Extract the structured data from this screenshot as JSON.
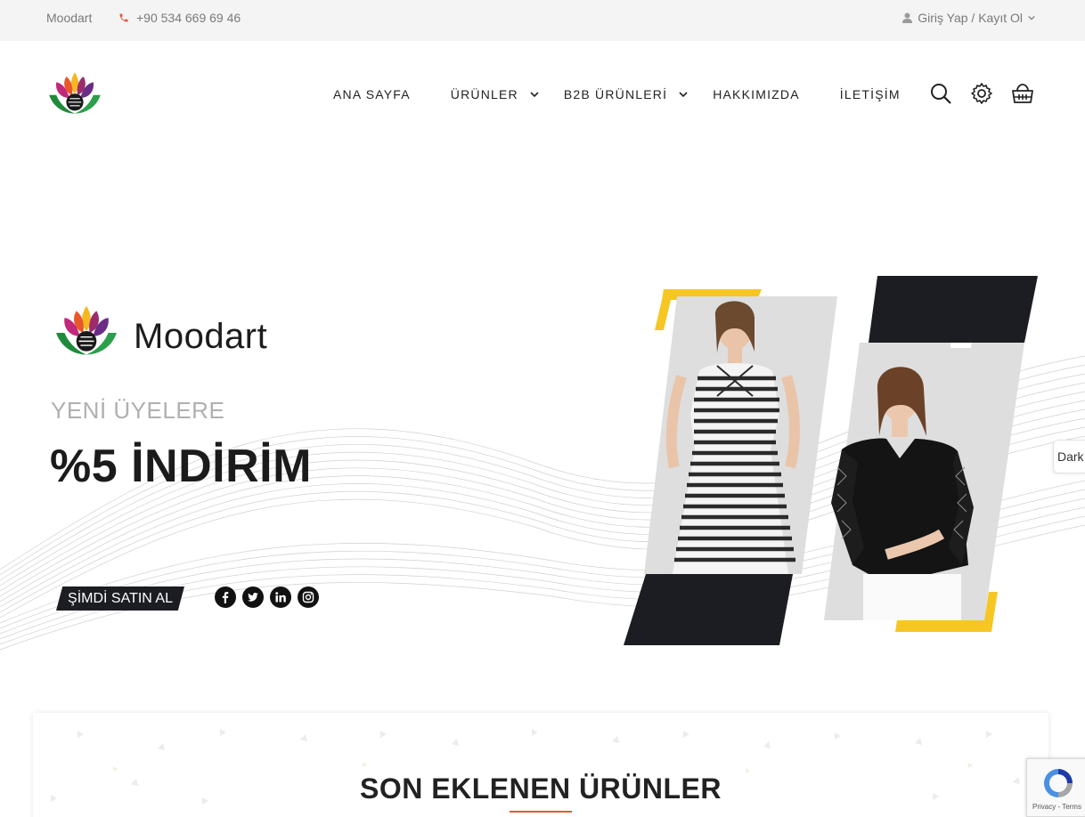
{
  "topbar": {
    "brand": "Moodart",
    "phone": "+90 534 669 69 46",
    "account": "Giriş Yap / Kayıt Ol"
  },
  "nav": {
    "items": [
      {
        "label": "ANA SAYFA",
        "has_dropdown": false
      },
      {
        "label": "ÜRÜNLER",
        "has_dropdown": true
      },
      {
        "label": "B2B ÜRÜNLERİ",
        "has_dropdown": true
      },
      {
        "label": "HAKKIMIZDA",
        "has_dropdown": false
      },
      {
        "label": "İLETİŞİM",
        "has_dropdown": false
      }
    ],
    "icons": [
      "search-icon",
      "settings-gear-icon",
      "shopping-basket-icon"
    ]
  },
  "hero": {
    "logo_text": "Moodart",
    "tagline": "YENİ ÜYELERE",
    "headline": "%5 İNDİRİM",
    "cta_label": "ŞİMDİ SATIN AL",
    "socials": [
      "facebook-icon",
      "twitter-icon",
      "linkedin-icon",
      "instagram-icon"
    ]
  },
  "dark_toggle": {
    "label": "Dark"
  },
  "latest": {
    "title": "SON EKLENEN ÜRÜNLER"
  },
  "recaptcha": {
    "links": "Privacy - Terms"
  },
  "colors": {
    "accent_red": "#e2573b",
    "accent_yellow": "#f6c623",
    "dark": "#1b1d22",
    "topbar_bg": "#f4f4f4"
  }
}
